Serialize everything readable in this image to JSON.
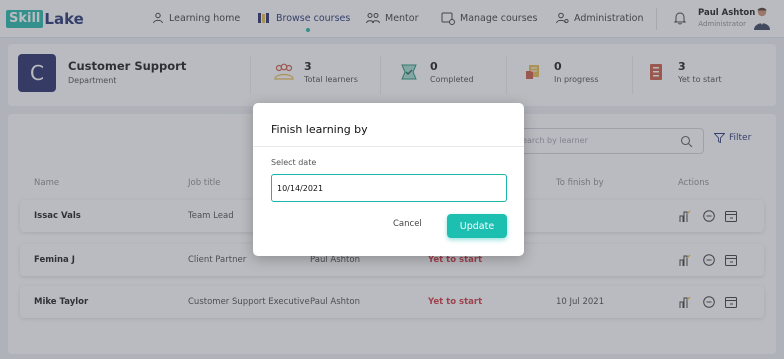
{
  "brand": {
    "part1": "Skill",
    "part2": "Lake"
  },
  "nav": {
    "items": [
      {
        "label": "Learning home",
        "icon": "users-icon"
      },
      {
        "label": "Browse courses",
        "icon": "books-icon",
        "active": true
      },
      {
        "label": "Mentor",
        "icon": "mentor-icon"
      },
      {
        "label": "Manage courses",
        "icon": "courses-icon"
      },
      {
        "label": "Administration",
        "icon": "admin-icon"
      }
    ],
    "user_name": "Paul Ashton",
    "user_role": "Administrator"
  },
  "department": {
    "initial": "C",
    "name": "Customer Support",
    "subtitle": "Department"
  },
  "stats": [
    {
      "value": "3",
      "label": "Total learners",
      "icon": "learners-icon"
    },
    {
      "value": "0",
      "label": "Completed",
      "icon": "completed-icon"
    },
    {
      "value": "0",
      "label": "In progress",
      "icon": "progress-icon"
    },
    {
      "value": "3",
      "label": "Yet to start",
      "icon": "yet-to-start-icon"
    }
  ],
  "search": {
    "placeholder": "Search by learner"
  },
  "filter_label": "Filter",
  "table": {
    "headers": [
      "Name",
      "Job title",
      "To finish by",
      "Actions"
    ],
    "rows": [
      {
        "name": "Issac Vals",
        "job": "Team Lead",
        "manager": "",
        "status": "",
        "finish": ""
      },
      {
        "name": "Femina J",
        "job": "Client Partner",
        "manager": "Paul Ashton",
        "status": "Yet to start",
        "finish": ""
      },
      {
        "name": "Mike Taylor",
        "job": "Customer Support Executive",
        "manager": "Paul Ashton",
        "status": "Yet to start",
        "finish": "10 Jul 2021"
      }
    ]
  },
  "modal": {
    "title": "Finish learning by",
    "field_label": "Select date",
    "date_value": "10/14/2021",
    "cancel_label": "Cancel",
    "update_label": "Update"
  },
  "colors": {
    "teal": "#1dbfb0",
    "navy": "#1a2463",
    "status_red": "#d0303a",
    "gold": "#e9b949"
  }
}
